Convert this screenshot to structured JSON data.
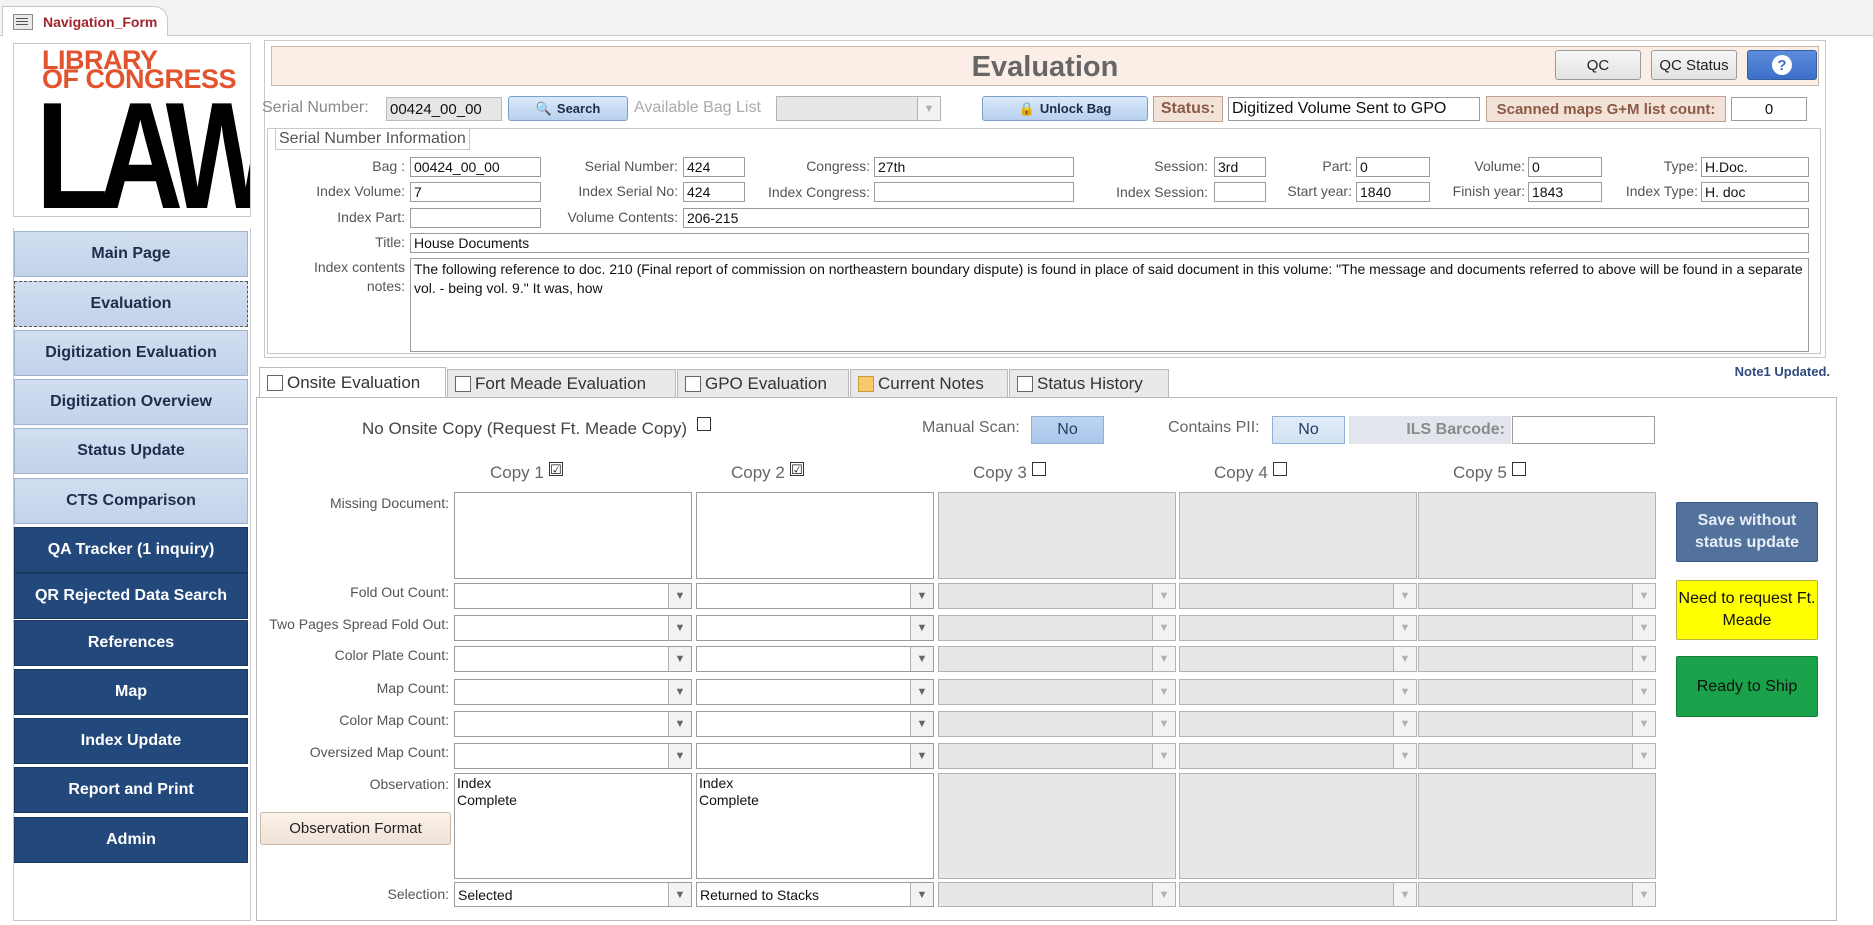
{
  "doc_tab": {
    "label": "Navigation_Form"
  },
  "logo": {
    "line1": "LIBRARY",
    "line2": "OF CONGRESS",
    "line3": "LAW"
  },
  "nav": [
    {
      "label": "Main Page"
    },
    {
      "label": "Evaluation"
    },
    {
      "label": "Digitization Evaluation"
    },
    {
      "label": "Digitization Overview"
    },
    {
      "label": "Status Update"
    },
    {
      "label": "CTS Comparison"
    },
    {
      "label": "QA Tracker (1 inquiry)"
    },
    {
      "label": "QR Rejected Data Search"
    },
    {
      "label": "References"
    },
    {
      "label": "Map"
    },
    {
      "label": "Index Update"
    },
    {
      "label": "Report and Print"
    },
    {
      "label": "Admin"
    }
  ],
  "header": {
    "title": "Evaluation",
    "qc": "QC",
    "qc_status": "QC Status",
    "help": "?",
    "serial_label": "Serial Number:",
    "serial_value": "00424_00_00",
    "search": "Search",
    "bag_list_label": "Available Bag List",
    "unlock": "Unlock Bag",
    "status_label": "Status:",
    "status_value": "Digitized Volume Sent to GPO",
    "maps_label": "Scanned maps G+M list count:",
    "maps_value": "0"
  },
  "info": {
    "legend": "Serial Number Information",
    "bag_label": "Bag :",
    "bag": "00424_00_00",
    "serial_label": "Serial Number:",
    "serial": "424",
    "congress_label": "Congress:",
    "congress": "27th",
    "session_label": "Session:",
    "session": "3rd",
    "part_label": "Part:",
    "part": "0",
    "volume_label": "Volume:",
    "volume": "0",
    "type_label": "Type:",
    "type": "H.Doc.",
    "index_volume_label": "Index Volume:",
    "index_volume": "7",
    "index_serial_label": "Index Serial No:",
    "index_serial": "424",
    "index_congress_label": "Index Congress:",
    "index_congress": "",
    "index_session_label": "Index Session:",
    "index_session": "",
    "start_label": "Start year:",
    "start": "1840",
    "finish_label": "Finish year:",
    "finish": "1843",
    "index_type_label": "Index Type:",
    "index_type": "H. doc",
    "index_part_label": "Index Part:",
    "index_part": "",
    "volume_contents_label": "Volume Contents:",
    "volume_contents": "206-215",
    "title_label": "Title:",
    "title": "House Documents",
    "notes_label_1": "Index contents",
    "notes_label_2": "notes:",
    "notes": "The following reference to doc. 210 (Final report of commission on northeastern boundary dispute) is found in place of said document in this volume: \"The message and documents referred to above will be found in a separate vol. - being vol. 9.\" It was, how"
  },
  "note_updated": "Note1 Updated.",
  "tabs": [
    {
      "label": "Onsite Evaluation"
    },
    {
      "label": "Fort Meade Evaluation"
    },
    {
      "label": "GPO Evaluation"
    },
    {
      "label": "Current Notes"
    },
    {
      "label": "Status History"
    }
  ],
  "onsite": {
    "no_onsite_label": "No Onsite Copy (Request Ft. Meade Copy)",
    "manual_scan_label": "Manual Scan:",
    "manual_scan": "No",
    "pii_label": "Contains PII:",
    "pii": "No",
    "ils_label": "ILS Barcode:",
    "ils": "",
    "copies": [
      {
        "label": "Copy 1",
        "checked": "☑"
      },
      {
        "label": "Copy 2",
        "checked": "☑"
      },
      {
        "label": "Copy 3",
        "checked": ""
      },
      {
        "label": "Copy 4",
        "checked": ""
      },
      {
        "label": "Copy 5",
        "checked": ""
      }
    ],
    "rows": {
      "missing": "Missing Document:",
      "fold_out": "Fold Out Count:",
      "two_pages": "Two Pages Spread Fold Out:",
      "color_plate": "Color Plate Count:",
      "map_count": "Map Count:",
      "color_map": "Color Map Count:",
      "oversized": "Oversized Map Count:",
      "observation": "Observation:",
      "selection": "Selection:"
    },
    "observation_1": "Index\nComplete",
    "observation_2": "Index\nComplete",
    "selection_1": "Selected",
    "selection_2": "Returned to Stacks",
    "observation_format": "Observation Format",
    "save_btn": "Save without status update",
    "ftmeade_btn": "Need to request Ft. Meade",
    "ship_btn": "Ready to Ship"
  },
  "colors": {
    "nav_dark": "#23497c",
    "accent_yellow": "#ffff00",
    "accent_green": "#1aa24a",
    "save_blue": "#52729c"
  }
}
